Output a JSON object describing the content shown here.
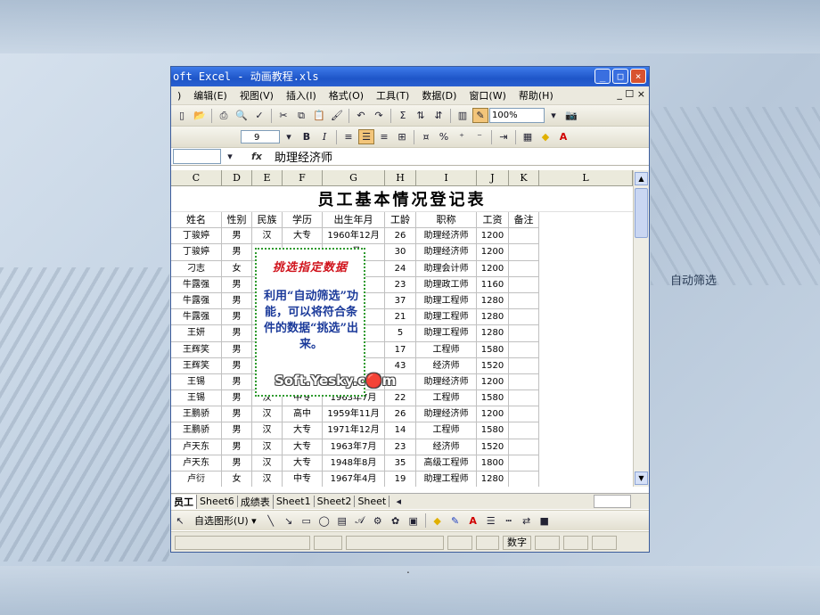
{
  "slide": {
    "side_label": "自动筛选",
    "footer_dot": "."
  },
  "window": {
    "title": "oft Excel - 动画教程.xls",
    "min": "_",
    "max": "□",
    "close": "×"
  },
  "menu": {
    "items": [
      "编辑(E)",
      "视图(V)",
      "插入(I)",
      "格式(O)",
      "工具(T)",
      "数据(D)",
      "窗口(W)",
      "帮助(H)"
    ],
    "lead": ")",
    "right": "_ ☐ ×"
  },
  "toolbar": {
    "zoom": "100%",
    "font_size": "9",
    "bold": "B",
    "italic": "I",
    "percent": "%",
    "sigma": "Σ"
  },
  "formula": {
    "fx": "fx",
    "value": "助理经济师"
  },
  "columns": [
    "C",
    "D",
    "E",
    "F",
    "G",
    "H",
    "I",
    "J",
    "K",
    "L"
  ],
  "sheet_title": "员工基本情况登记表",
  "table": {
    "headers": [
      "姓名",
      "性别",
      "民族",
      "学历",
      "出生年月",
      "工龄",
      "职称",
      "工资",
      "备注"
    ],
    "rows": [
      [
        "丁骏婷",
        "男",
        "汉",
        "大专",
        "1960年12月",
        "26",
        "助理经济师",
        "1200",
        ""
      ],
      [
        "丁骏婷",
        "男",
        "",
        "",
        "2月",
        "30",
        "助理经济师",
        "1200",
        ""
      ],
      [
        "刁志",
        "女",
        "",
        "",
        "月",
        "24",
        "助理会计师",
        "1200",
        ""
      ],
      [
        "牛露强",
        "男",
        "",
        "",
        "月",
        "23",
        "助理政工师",
        "1160",
        ""
      ],
      [
        "牛露强",
        "男",
        "",
        "",
        "月",
        "37",
        "助理工程师",
        "1280",
        ""
      ],
      [
        "牛露强",
        "男",
        "",
        "",
        "月",
        "21",
        "助理工程师",
        "1280",
        ""
      ],
      [
        "王妍",
        "男",
        "",
        "",
        "2月",
        "5",
        "助理工程师",
        "1280",
        ""
      ],
      [
        "王辉笑",
        "男",
        "",
        "",
        "2月",
        "17",
        "工程师",
        "1580",
        ""
      ],
      [
        "王辉笑",
        "男",
        "",
        "",
        "1月",
        "43",
        "经济师",
        "1520",
        ""
      ],
      [
        "王锡",
        "男",
        "",
        "",
        "",
        "",
        "助理经济师",
        "1200",
        ""
      ],
      [
        "王锡",
        "男",
        "汉",
        "中专",
        "1963年7月",
        "22",
        "工程师",
        "1580",
        ""
      ],
      [
        "王鹏骄",
        "男",
        "汉",
        "高中",
        "1959年11月",
        "26",
        "助理经济师",
        "1200",
        ""
      ],
      [
        "王鹏骄",
        "男",
        "汉",
        "大专",
        "1971年12月",
        "14",
        "工程师",
        "1580",
        ""
      ],
      [
        "卢天东",
        "男",
        "汉",
        "大专",
        "1963年7月",
        "23",
        "经济师",
        "1520",
        ""
      ],
      [
        "卢天东",
        "男",
        "汉",
        "大专",
        "1948年8月",
        "35",
        "高级工程师",
        "1800",
        ""
      ],
      [
        "卢衍",
        "女",
        "汉",
        "中专",
        "1967年4月",
        "19",
        "助理工程师",
        "1280",
        ""
      ]
    ]
  },
  "tabs": [
    "员工",
    "Sheet6",
    "成绩表",
    "Sheet1",
    "Sheet2",
    "Sheet"
  ],
  "drawbar": {
    "autoshapes": "自选图形(U) ▾"
  },
  "status": {
    "mode": "数字"
  },
  "callout": {
    "title": "挑选指定数据",
    "body": "利用“自动筛选”功能，可以将符合条件的数据“挑选”出来。"
  },
  "watermark": "Soft.Yesky.c🔴m"
}
